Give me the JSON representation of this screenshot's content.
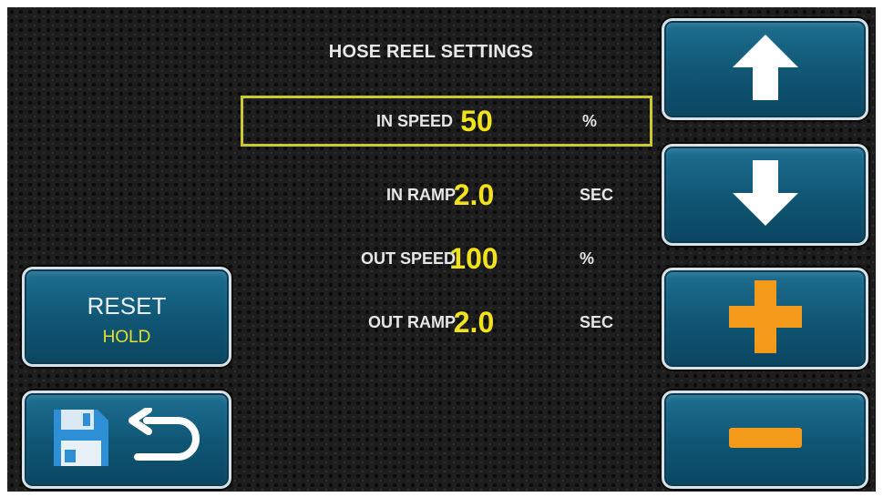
{
  "title": "HOSE REEL SETTINGS",
  "settings": [
    {
      "label": "IN SPEED",
      "value": "50",
      "unit": "%"
    },
    {
      "label": "IN RAMP",
      "value": "2.0",
      "unit": "SEC"
    },
    {
      "label": "OUT SPEED",
      "value": "100",
      "unit": "%"
    },
    {
      "label": "OUT RAMP",
      "value": "2.0",
      "unit": "SEC"
    }
  ],
  "selected_row": 0,
  "buttons": {
    "reset_label": "RESET",
    "reset_sublabel": "HOLD",
    "up_icon": "arrow-up-icon",
    "down_icon": "arrow-down-icon",
    "plus_icon": "plus-icon",
    "minus_icon": "minus-icon",
    "save_icon": "floppy-disk-icon",
    "return_icon": "return-arrow-icon"
  },
  "colors": {
    "value": "#f1e21a",
    "selection_border": "#cbc92e",
    "button": "#0f5573",
    "plus_minus": "#f39a1b",
    "hold": "#e2e030"
  }
}
